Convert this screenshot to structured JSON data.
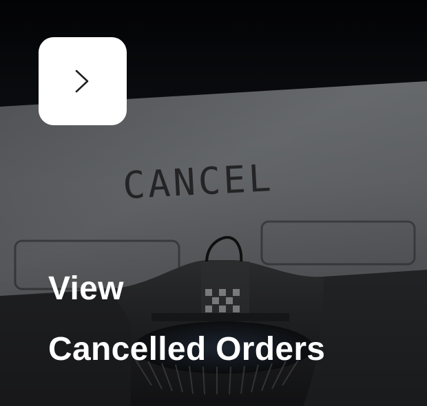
{
  "card": {
    "background_image": "typewriter-cancel-photo",
    "nav_icon": "chevron-right-icon",
    "caption_line1": "View",
    "caption_line2": "Cancelled Orders",
    "paper_text": "CANCEL"
  },
  "colors": {
    "caption_text": "#ffffff",
    "button_background": "#ffffff",
    "chevron": "#1f1f1f"
  }
}
